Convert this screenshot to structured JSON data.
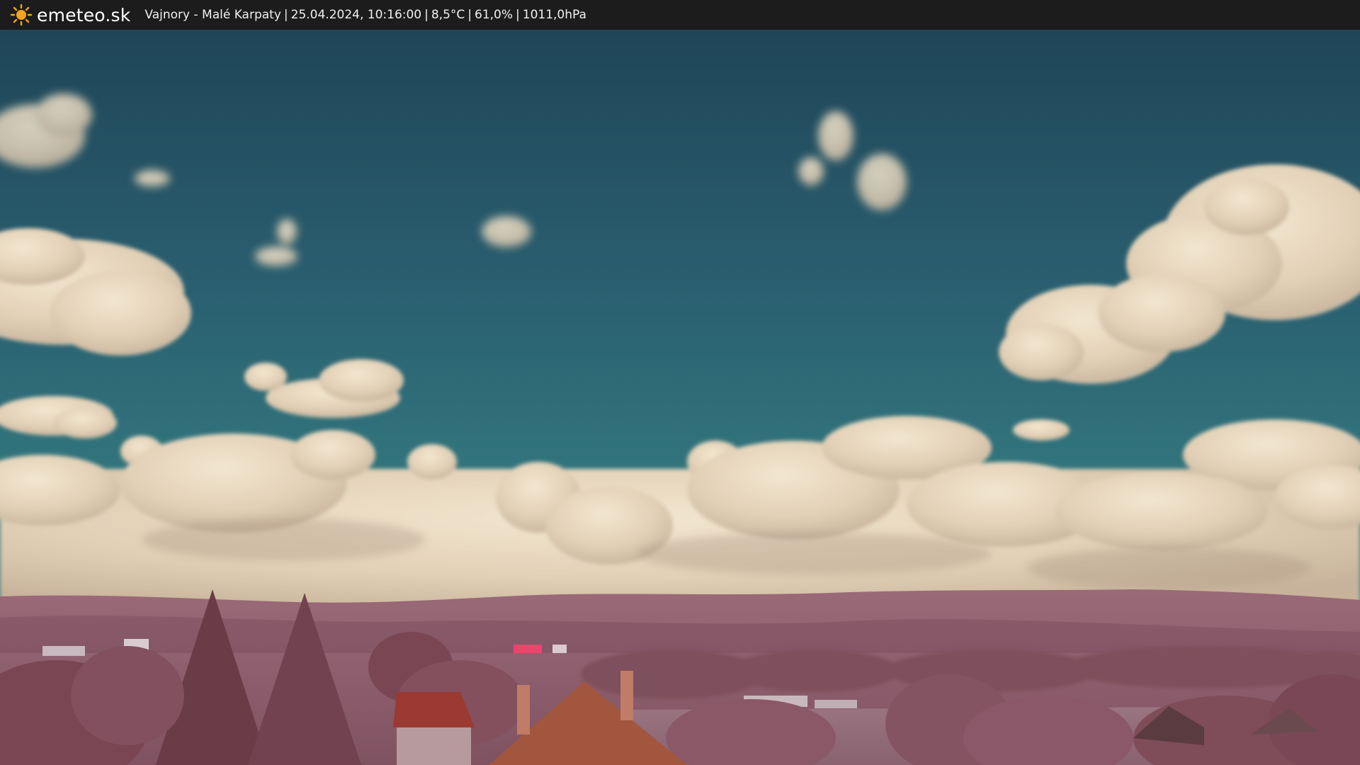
{
  "header": {
    "brand": "emeteo.sk",
    "brand_icon": "sun-icon",
    "location": "Vajnory - Malé Karpaty",
    "timestamp": "25.04.2024, 10:16:00",
    "temperature": "8,5°C",
    "humidity": "61,0%",
    "pressure": "1011,0hPa",
    "separator": "|"
  },
  "colors": {
    "bar_bg": "#1c1c1c",
    "sun": "#f2a516",
    "sky_top": "#1f4a5a",
    "sky_mid": "#2f6f7c",
    "cloud": "#e6d6be",
    "hills": "#8d5c6c",
    "foliage": "#7e4a52",
    "roof": "#9c4a36"
  }
}
